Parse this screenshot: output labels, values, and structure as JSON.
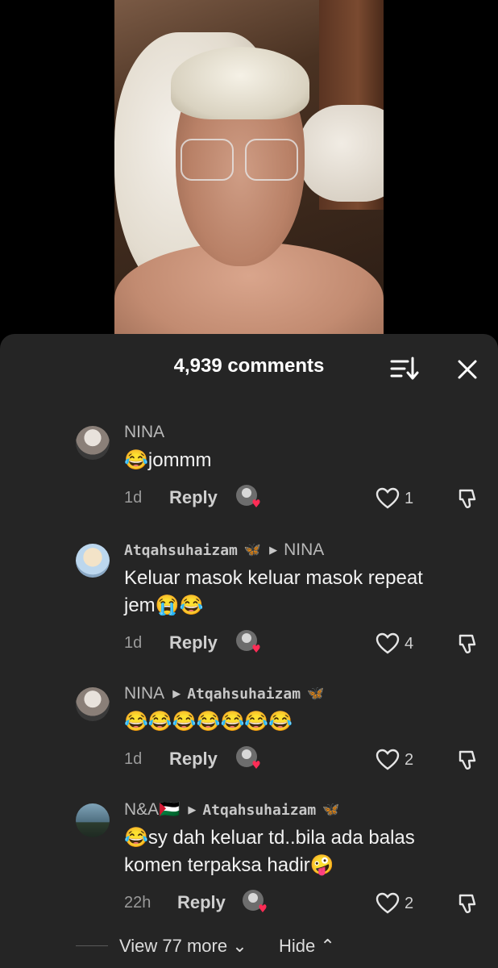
{
  "comments_header": {
    "title": "4,939 comments"
  },
  "comments": [
    {
      "username": "NINA",
      "reply_to": "",
      "text_lines": [
        "😂jommm"
      ],
      "age": "1d",
      "reply_label": "Reply",
      "likes": "1"
    },
    {
      "username": "Atqahsuhaizam",
      "username_emoji": "🦋",
      "reply_to": "NINA",
      "text_lines": [
        "Keluar masok keluar masok repeat",
        "jem😭😂"
      ],
      "age": "1d",
      "reply_label": "Reply",
      "likes": "4"
    },
    {
      "username": "NINA",
      "reply_to": "Atqahsuhaizam",
      "reply_to_emoji": "🦋",
      "text_lines": [
        "😂😂😂😂😂😂😂"
      ],
      "age": "1d",
      "reply_label": "Reply",
      "likes": "2"
    },
    {
      "username": "N&A🇵🇸",
      "reply_to": "Atqahsuhaizam",
      "reply_to_emoji": "🦋",
      "text_lines": [
        "😂sy dah keluar td..bila ada balas",
        "komen terpaksa hadir🤪"
      ],
      "age": "22h",
      "reply_label": "Reply",
      "likes": "2"
    }
  ],
  "footer": {
    "view_more": "View 77 more ⌄",
    "hide": "Hide ⌃"
  },
  "colors": {
    "sheet_bg": "#252525",
    "accent_heart": "#fe2c55"
  },
  "icons": {
    "sort": "sort-icon",
    "close": "close-icon",
    "like": "heart-outline-icon",
    "dislike": "thumbs-down-icon"
  }
}
